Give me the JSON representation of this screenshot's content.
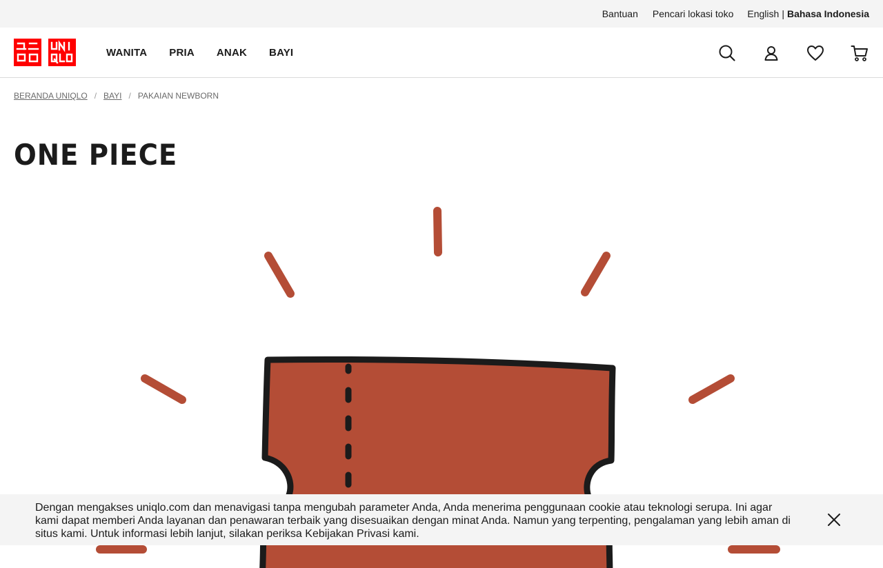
{
  "utility": {
    "help": "Bantuan",
    "store_locator": "Pencari lokasi toko",
    "lang_en": "English",
    "lang_sep": "|",
    "lang_id": "Bahasa Indonesia"
  },
  "brand": {
    "logo_top_left": "ユニ",
    "logo_bottom_left": "クロ",
    "logo_top_right": "UNI",
    "logo_bottom_right": "QLO",
    "color": "#ff0000"
  },
  "nav": {
    "items": [
      {
        "label": "WANITA"
      },
      {
        "label": "PRIA"
      },
      {
        "label": "ANAK"
      },
      {
        "label": "BAYI"
      }
    ]
  },
  "header_icons": [
    "search-icon",
    "account-icon",
    "wishlist-heart-icon",
    "cart-icon"
  ],
  "breadcrumb": {
    "home": "BERANDA UNIQLO",
    "sep1": "/",
    "level1": "BAYI",
    "sep2": "/",
    "current": "PAKAIAN NEWBORN"
  },
  "page": {
    "title": "ONE PIECE"
  },
  "illustration": {
    "fill_color": "#b44d36",
    "outline_color": "#1b1b1b"
  },
  "cookie": {
    "text": "Dengan mengakses uniqlo.com dan menavigasi tanpa mengubah parameter Anda, Anda menerima penggunaan cookie atau teknologi serupa. Ini agar kami dapat memberi Anda layanan dan penawaran terbaik yang disesuaikan dengan minat Anda. Namun yang terpenting, pengalaman yang lebih aman di situs kami. Untuk informasi lebih lanjut, silakan periksa Kebijakan Privasi kami."
  }
}
